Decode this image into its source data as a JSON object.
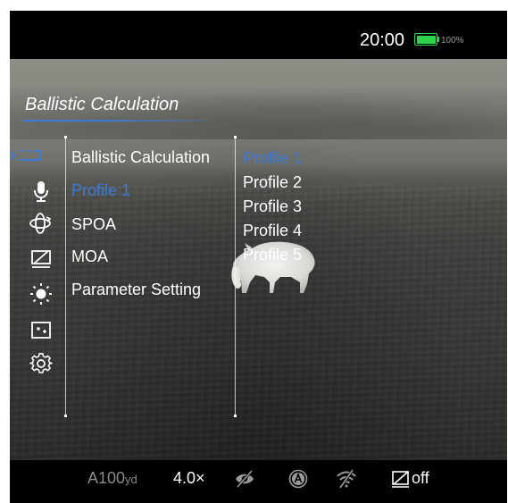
{
  "status_bar": {
    "time": "20:00",
    "battery_percent": "100%",
    "battery_level": 1.0,
    "battery_color": "#2ad34a"
  },
  "screen": {
    "title": "Ballistic Calculation"
  },
  "side_icons": [
    {
      "name": "ballistic-icon",
      "active": true
    },
    {
      "name": "microphone-icon"
    },
    {
      "name": "rotate-3d-icon"
    },
    {
      "name": "display-off-icon"
    },
    {
      "name": "brightness-icon"
    },
    {
      "name": "picture-in-picture-icon"
    },
    {
      "name": "settings-gear-icon"
    }
  ],
  "menu": {
    "items": [
      {
        "label": "Ballistic Calculation",
        "active": false
      },
      {
        "label": "Profile 1",
        "active": true
      },
      {
        "label": "SPOA",
        "active": false
      },
      {
        "label": "MOA",
        "active": false
      },
      {
        "label": "Parameter Setting",
        "active": false
      }
    ]
  },
  "profiles": {
    "items": [
      {
        "label": "Profile 1",
        "active": true
      },
      {
        "label": "Profile 2",
        "active": false
      },
      {
        "label": "Profile 3",
        "active": false
      },
      {
        "label": "Profile 4",
        "active": false
      },
      {
        "label": "Profile 5",
        "active": false
      }
    ]
  },
  "bottom_bar": {
    "range": "A100",
    "range_unit": "yd",
    "zoom": "4.0×",
    "display_off_label": "off",
    "icons": [
      "eye-off-icon",
      "auto-mode-icon",
      "wifi-off-icon",
      "display-off-icon"
    ]
  },
  "colors": {
    "accent": "#3d7bd8",
    "text": "#ffffff",
    "muted": "#8a8a8a",
    "bar_bg": "#000000"
  }
}
